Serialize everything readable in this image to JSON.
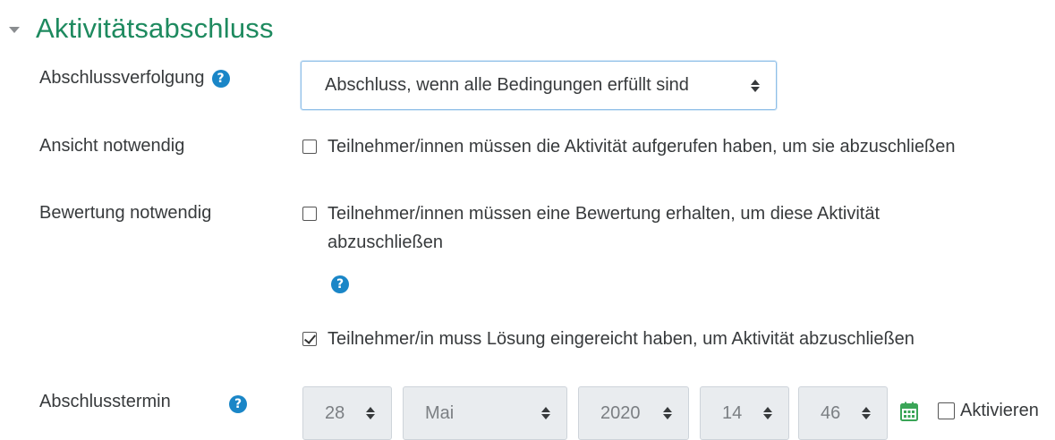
{
  "section": {
    "title": "Aktivitätsabschluss"
  },
  "completion_tracking": {
    "label": "Abschlussverfolgung",
    "help_symbol": "?",
    "selected_value": "Abschluss, wenn alle Bedingungen erfüllt sind"
  },
  "require_view": {
    "label": "Ansicht notwendig",
    "checkbox_label": "Teilnehmer/innen müssen die Aktivität aufgerufen haben, um sie abzuschließen",
    "checked": false
  },
  "require_grade": {
    "label": "Bewertung notwendig",
    "checkbox_label_line1": "Teilnehmer/innen müssen eine Bewertung erhalten, um diese Aktivität",
    "checkbox_label_line2": "abzuschließen",
    "checked": false,
    "help_symbol": "?"
  },
  "require_submit": {
    "checkbox_label": "Teilnehmer/in muss Lösung eingereicht haben, um Aktivität abzuschließen",
    "checked": true
  },
  "expected_completion": {
    "label": "Abschlusstermin",
    "help_symbol": "?",
    "day": "28",
    "month": "Mai",
    "year": "2020",
    "hour": "14",
    "minute": "46",
    "enable_label": "Aktivieren",
    "enabled": false
  },
  "colors": {
    "title_green": "#1e8a5f",
    "help_blue": "#1a86c7",
    "calendar_green": "#3aa557",
    "disabled_bg": "#e9ecef",
    "focus_border": "#8fbfe8"
  }
}
